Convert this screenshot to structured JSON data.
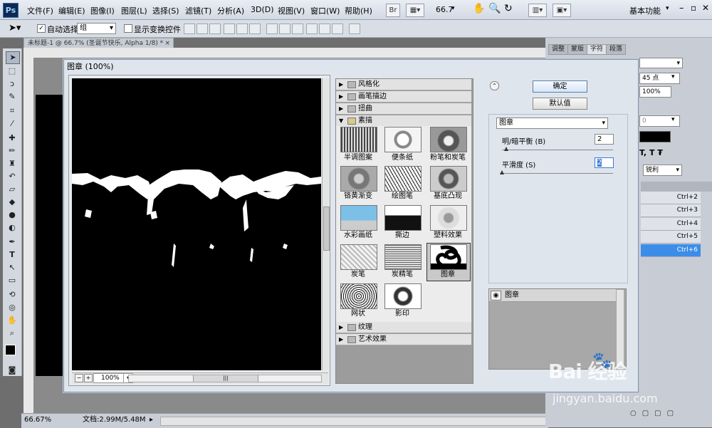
{
  "app": {
    "logo": "Ps"
  },
  "menubar": {
    "items": [
      "文件(F)",
      "编辑(E)",
      "图像(I)",
      "图层(L)",
      "选择(S)",
      "滤镜(T)",
      "分析(A)",
      "3D(D)",
      "视图(V)",
      "窗口(W)",
      "帮助(H)"
    ],
    "zoom": "66.7",
    "workspace": "基本功能"
  },
  "options_bar": {
    "auto_select_label": "自动选择:",
    "auto_select_value": "组",
    "show_transform_label": "显示变换控件"
  },
  "document": {
    "tab_title": "未标题-1 @ 66.7% (圣诞节快乐, Alpha 1/8) *"
  },
  "status": {
    "zoom": "66.67%",
    "doc_size": "文档:2.99M/5.48M"
  },
  "right_panel": {
    "tabs": [
      "调整",
      "蒙版",
      "字符",
      "段落"
    ],
    "font_size": "45 点",
    "scale": "100%",
    "zero_value": "0",
    "antialias": "锐利",
    "shortcuts": [
      "Ctrl+2",
      "Ctrl+3",
      "Ctrl+4",
      "Ctrl+5",
      "Ctrl+6"
    ]
  },
  "dialog": {
    "title": "图章 (100%)",
    "zoom_value": "100%",
    "categories_top": [
      "风格化",
      "画笔描边",
      "扭曲",
      "素描"
    ],
    "categories_bottom": [
      "纹理",
      "艺术效果"
    ],
    "filters": [
      "半调图案",
      "便条纸",
      "粉笔和炭笔",
      "铬黄渐变",
      "绘图笔",
      "基底凸现",
      "水彩画纸",
      "撕边",
      "塑料效果",
      "炭笔",
      "炭精笔",
      "图章",
      "网状",
      "影印"
    ],
    "ok_label": "确定",
    "default_label": "默认值",
    "selected_filter": "图章",
    "params": [
      {
        "label": "明/暗平衡 (B)",
        "value": "2",
        "level": 0.04
      },
      {
        "label": "平滑度 (S)",
        "value": "2",
        "level": 0.0
      }
    ],
    "layer_name": "图章"
  },
  "watermark": {
    "main": "Bai 经验",
    "sub": "jingyan.baidu.com"
  }
}
